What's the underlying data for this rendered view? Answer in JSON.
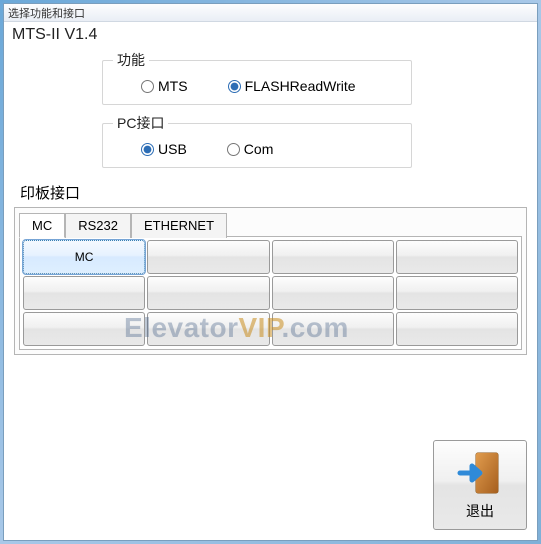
{
  "window": {
    "title": "选择功能和接口"
  },
  "version": "MTS-II V1.4",
  "groups": {
    "function": {
      "legend": "功能",
      "options": {
        "mts": {
          "label": "MTS",
          "checked": false
        },
        "flash": {
          "label": "FLASHReadWrite",
          "checked": true
        }
      }
    },
    "pcport": {
      "legend": "PC接口",
      "options": {
        "usb": {
          "label": "USB",
          "checked": true
        },
        "com": {
          "label": "Com",
          "checked": false
        }
      }
    }
  },
  "board_interface_label": "印板接口",
  "tabs": {
    "mc": "MC",
    "rs232": "RS232",
    "ethernet": "ETHERNET",
    "active": "mc"
  },
  "grid": {
    "cells": [
      "MC",
      "",
      "",
      "",
      "",
      "",
      "",
      "",
      "",
      "",
      "",
      ""
    ],
    "selected_index": 0
  },
  "exit_button": {
    "label": "退出"
  },
  "watermark": {
    "part1": "Elevator",
    "part2": "VIP",
    "part3": ".com"
  }
}
